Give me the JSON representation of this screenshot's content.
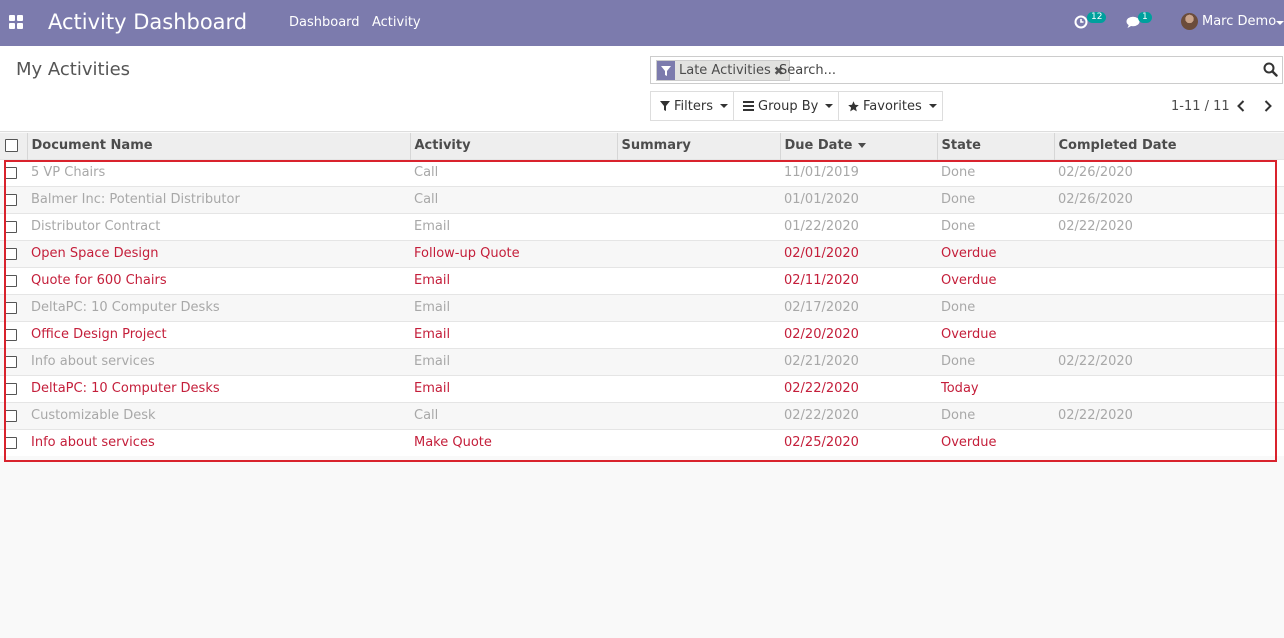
{
  "navbar": {
    "app_title": "Activity Dashboard",
    "menu": [
      "Dashboard",
      "Activity"
    ],
    "activity_badge": "12",
    "messages_badge": "1",
    "user_name": "Marc Demo",
    "bg_color": "#7c7bad"
  },
  "control_panel": {
    "title": "My Activities",
    "facet_label": "Late Activities",
    "facet_remove": "✖",
    "search_placeholder": "Search...",
    "filters_label": "Filters",
    "group_by_label": "Group By",
    "favorites_label": "Favorites",
    "pager_value": "1-11 / 11"
  },
  "table": {
    "columns": [
      "Document Name",
      "Activity",
      "Summary",
      "Due Date",
      "State",
      "Completed Date"
    ],
    "rows": [
      {
        "document": "5 VP Chairs",
        "activity": "Call",
        "summary": "",
        "due": "11/01/2019",
        "state": "Done",
        "completed": "02/26/2020",
        "kind": "done"
      },
      {
        "document": "Balmer Inc: Potential Distributor",
        "activity": "Call",
        "summary": "",
        "due": "01/01/2020",
        "state": "Done",
        "completed": "02/26/2020",
        "kind": "done"
      },
      {
        "document": "Distributor Contract",
        "activity": "Email",
        "summary": "",
        "due": "01/22/2020",
        "state": "Done",
        "completed": "02/22/2020",
        "kind": "done"
      },
      {
        "document": "Open Space Design",
        "activity": "Follow-up Quote",
        "summary": "",
        "due": "02/01/2020",
        "state": "Overdue",
        "completed": "",
        "kind": "overdue"
      },
      {
        "document": "Quote for 600 Chairs",
        "activity": "Email",
        "summary": "",
        "due": "02/11/2020",
        "state": "Overdue",
        "completed": "",
        "kind": "overdue"
      },
      {
        "document": "DeltaPC: 10 Computer Desks",
        "activity": "Email",
        "summary": "",
        "due": "02/17/2020",
        "state": "Done",
        "completed": "",
        "kind": "done"
      },
      {
        "document": "Office Design Project",
        "activity": "Email",
        "summary": "",
        "due": "02/20/2020",
        "state": "Overdue",
        "completed": "",
        "kind": "overdue"
      },
      {
        "document": "Info about services",
        "activity": "Email",
        "summary": "",
        "due": "02/21/2020",
        "state": "Done",
        "completed": "02/22/2020",
        "kind": "done"
      },
      {
        "document": "DeltaPC: 10 Computer Desks",
        "activity": "Email",
        "summary": "",
        "due": "02/22/2020",
        "state": "Today",
        "completed": "",
        "kind": "today"
      },
      {
        "document": "Customizable Desk",
        "activity": "Call",
        "summary": "",
        "due": "02/22/2020",
        "state": "Done",
        "completed": "02/22/2020",
        "kind": "done"
      },
      {
        "document": "Info about services",
        "activity": "Make Quote",
        "summary": "",
        "due": "02/25/2020",
        "state": "Overdue",
        "completed": "",
        "kind": "overdue"
      }
    ]
  },
  "colors": {
    "overdue": "#c41e3a",
    "done": "#a8a8a8",
    "highlight": "#d9232d"
  }
}
